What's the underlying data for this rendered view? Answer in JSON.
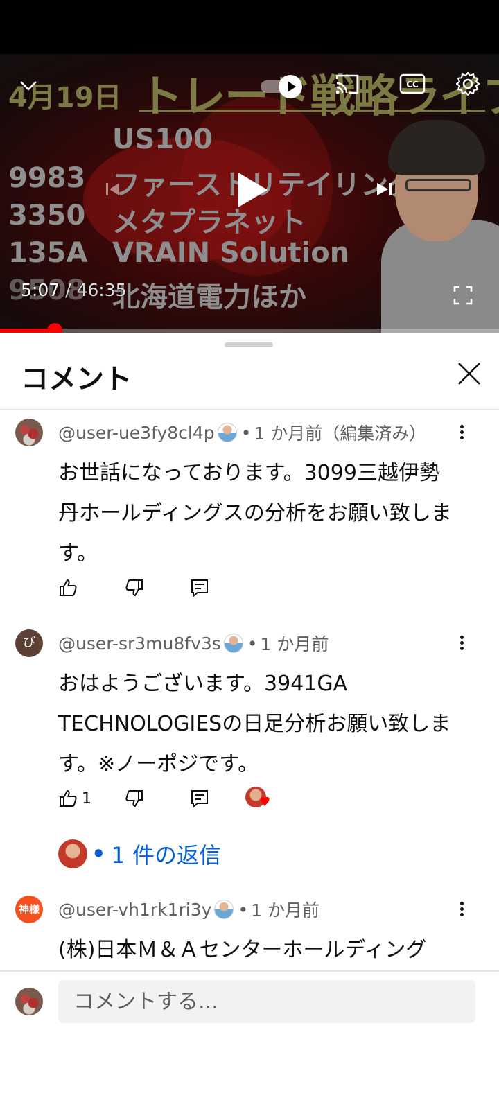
{
  "player": {
    "thumbnail": {
      "date": "4月19日",
      "title": "トレード戦略ライブ",
      "rows": [
        {
          "code": "",
          "name": "US100"
        },
        {
          "code": "9983",
          "name": "ファーストリテイリング"
        },
        {
          "code": "3350",
          "name": "メタプラネット"
        },
        {
          "code": "135A",
          "name": "VRAIN  Solution"
        },
        {
          "code": "9508",
          "name": "北海道電力ほか"
        }
      ]
    },
    "current_time": "5:07",
    "separator": " / ",
    "duration": "46:35",
    "progress_fraction": 0.11,
    "icons": [
      "chevron-down-icon",
      "autoplay-toggle",
      "cast-icon",
      "closed-captions-icon",
      "settings-gear-icon",
      "previous-icon",
      "play-icon",
      "next-icon",
      "fullscreen-icon"
    ],
    "accent_color": "#ff0000"
  },
  "panel": {
    "title": "コメント"
  },
  "comments": [
    {
      "author": "@user-ue3fy8cl4p",
      "time": "1 か月前（編集済み）",
      "text": "お世話になっております。3099三越伊勢丹ホールディングスの分析をお願い致します。",
      "likes": ""
    },
    {
      "author": "@user-sr3mu8fv3s",
      "avatar_letter": "び",
      "time": "1 か月前",
      "text": "おはようございます。3941GA TECHNOLOGIESの日足分析お願い致します。※ノーポジです。",
      "likes": "1",
      "replies": "1 件の返信"
    },
    {
      "author": "@user-vh1rk1ri3y",
      "avatar_letter": "神様",
      "time": "1 か月前",
      "text": "(株)日本Ｍ＆Ａセンターホールディング",
      "likes": ""
    }
  ],
  "compose": {
    "placeholder": "コメントする..."
  }
}
